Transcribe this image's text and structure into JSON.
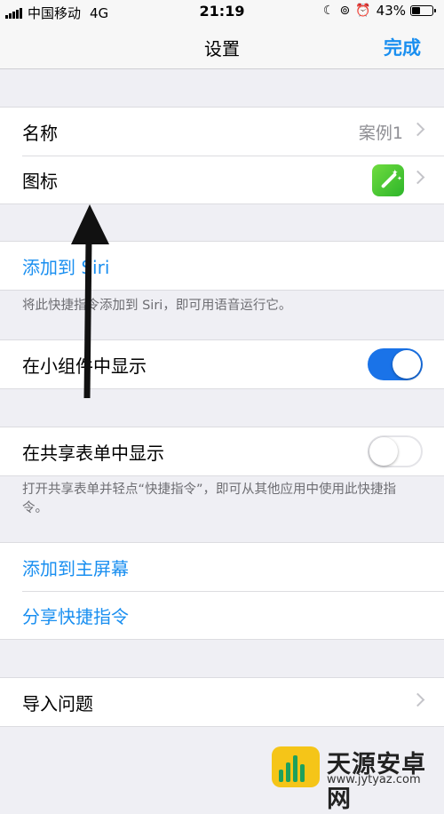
{
  "status_bar": {
    "carrier": "中国移动",
    "network": "4G",
    "time": "21:19",
    "battery": "43%",
    "battery_level": 0.43,
    "icons": [
      "moon-icon",
      "orientation-lock-icon",
      "alarm-icon"
    ]
  },
  "nav": {
    "title": "设置",
    "done_label": "完成"
  },
  "group1": {
    "name_label": "名称",
    "name_value": "案例1",
    "icon_label": "图标",
    "icon_name": "magic-wand-icon",
    "icon_color": "#4cd137"
  },
  "siri": {
    "add_label": "添加到 Siri",
    "note": "将此快捷指令添加到 Siri，即可用语音运行它。"
  },
  "widget": {
    "label": "在小组件中显示",
    "enabled": true
  },
  "share_sheet": {
    "label": "在共享表单中显示",
    "enabled": false,
    "note": "打开共享表单并轻点“快捷指令”，即可从其他应用中使用此快捷指令。"
  },
  "actions": {
    "home_screen_label": "添加到主屏幕",
    "share_label": "分享快捷指令"
  },
  "import": {
    "label": "导入问题"
  },
  "watermark": {
    "title": "天源安卓网",
    "url": "www.jytyaz.com"
  },
  "colors": {
    "accent": "#1a8ff0",
    "toggle_on": "#1a73e8",
    "background": "#efeff4"
  }
}
